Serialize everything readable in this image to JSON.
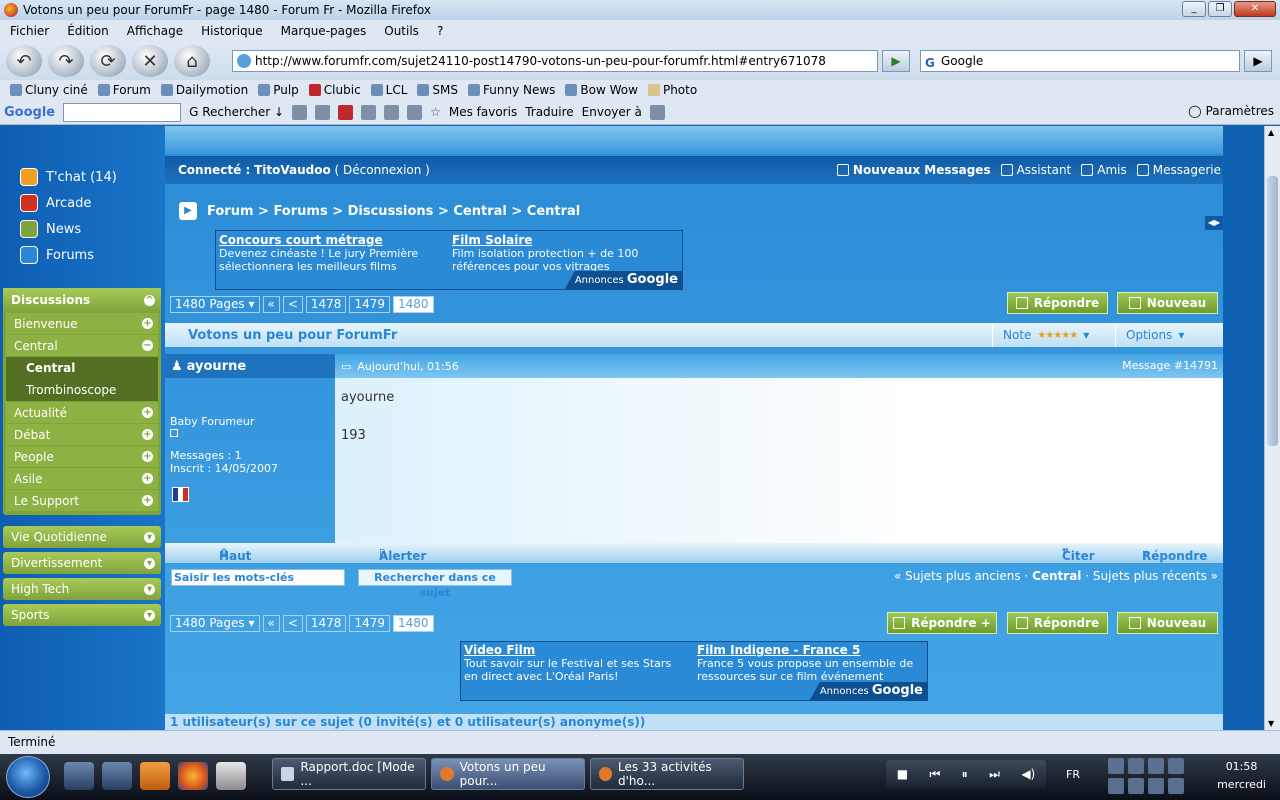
{
  "window": {
    "title": "Votons un peu pour ForumFr - page 1480 - Forum Fr - Mozilla Firefox"
  },
  "menu": [
    "Fichier",
    "Édition",
    "Affichage",
    "Historique",
    "Marque-pages",
    "Outils",
    "?"
  ],
  "nav": {
    "url": "http://www.forumfr.com/sujet24110-post14790-votons-un-peu-pour-forumfr.html#entry671078",
    "search_engine": "Google"
  },
  "bookmarks": [
    "Cluny ciné",
    "Forum",
    "Dailymotion",
    "Pulp",
    "Clubic",
    "LCL",
    "SMS",
    "Funny News",
    "Bow Wow",
    "Photo"
  ],
  "googlebar": {
    "logo": "Google",
    "search_label": "Rechercher",
    "favorites": "Mes favoris",
    "translate": "Traduire",
    "send": "Envoyer à",
    "settings": "Paramètres"
  },
  "left": {
    "links": [
      "T'chat (14)",
      "Arcade",
      "News",
      "Forums"
    ],
    "discussions_header": "Discussions",
    "items": [
      "Bienvenue",
      "Central"
    ],
    "sub_items": [
      "Central",
      "Trombinoscope"
    ],
    "items2": [
      "Actualité",
      "Débat",
      "People",
      "Asile",
      "Le Support"
    ],
    "categories": [
      "Vie Quotidienne",
      "Divertissement",
      "High Tech",
      "Sports"
    ]
  },
  "forum": {
    "connected_label": "Connecté :",
    "username": "TitoVaudoo",
    "logout": "( Déconnexion )",
    "top_links": [
      "Nouveaux Messages",
      "Assistant",
      "Amis",
      "Messagerie"
    ],
    "breadcrumb": "Forum > Forums > Discussions > Central > Central",
    "ads_top": [
      {
        "title": "Concours court métrage",
        "text": "Devenez cinéaste ! Le jury Première sélectionnera les meilleurs films"
      },
      {
        "title": "Film Solaire",
        "text": "Film isolation protection + de 100 références pour vos vitrages"
      }
    ],
    "ads_bottom": [
      {
        "title": "Video Film",
        "text": "Tout savoir sur le Festival et ses Stars en direct avec L'Oréal Paris!"
      },
      {
        "title": "Film Indigene - France 5",
        "text": "France 5 vous propose un ensemble de ressources sur ce film événement"
      }
    ],
    "ads_tag": "Annonces",
    "ads_tag_brand": "Google",
    "pager": {
      "pages": "1480 Pages ▾",
      "first": "«",
      "prev": "<",
      "p1": "1478",
      "p2": "1479",
      "current": "1480"
    },
    "buttons": {
      "reply": "Répondre",
      "new": "Nouveau",
      "reply_plus": "Répondre +"
    },
    "thread_title": "Votons un peu pour ForumFr",
    "note_label": "Note",
    "rating_stars": 5,
    "options_label": "Options",
    "post": {
      "author": "ayourne",
      "date": "Aujourd'hui, 01:56",
      "message_id": "Message #14791",
      "rank": "Baby Forumeur",
      "messages": "Messages : 1",
      "registered": "Inscrit : 14/05/2007",
      "body_line1": "ayourne",
      "body_line2": "193"
    },
    "post_footer": {
      "top": "Haut",
      "alert": "Alerter",
      "quote": "Citer",
      "reply": "Répondre"
    },
    "keywords_placeholder": "Saisir les mots-clés",
    "search_thread": "Rechercher dans ce sujet",
    "thread_nav": {
      "older": "« Sujets plus anciens",
      "sep": "·",
      "current": "Central",
      "newer": "Sujets plus récents »"
    },
    "users_line": "1 utilisateur(s) sur ce sujet (0 invité(s) et 0 utilisateur(s) anonyme(s))"
  },
  "status": "Terminé",
  "taskbar": {
    "tasks": [
      "Rapport.doc [Mode ...",
      "Votons un peu pour...",
      "Les 33 activités d'ho..."
    ],
    "lang": "FR",
    "time": "01:58",
    "day": "mercredi"
  },
  "colors": {
    "forum_blue": "#2a86d6",
    "green": "#7fa43c",
    "dark_blue": "#0f5aa4"
  }
}
